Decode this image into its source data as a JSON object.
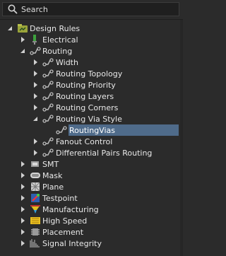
{
  "search": {
    "placeholder": "Search",
    "value": ""
  },
  "tree": {
    "root": {
      "label": "Design Rules",
      "expanded": true
    },
    "children": [
      {
        "label": "Electrical",
        "expanded": false
      },
      {
        "label": "Routing",
        "expanded": true,
        "children": [
          {
            "label": "Width",
            "expanded": false
          },
          {
            "label": "Routing Topology",
            "expanded": false
          },
          {
            "label": "Routing Priority",
            "expanded": false
          },
          {
            "label": "Routing Layers",
            "expanded": false
          },
          {
            "label": "Routing Corners",
            "expanded": false
          },
          {
            "label": "Routing Via Style",
            "expanded": true,
            "children": [
              {
                "label": "RoutingVias",
                "selected": true
              }
            ]
          },
          {
            "label": "Fanout Control",
            "expanded": false
          },
          {
            "label": "Differential Pairs Routing",
            "expanded": false
          }
        ]
      },
      {
        "label": "SMT",
        "expanded": false
      },
      {
        "label": "Mask",
        "expanded": false
      },
      {
        "label": "Plane",
        "expanded": false
      },
      {
        "label": "Testpoint",
        "expanded": false
      },
      {
        "label": "Manufacturing",
        "expanded": false
      },
      {
        "label": "High Speed",
        "expanded": false
      },
      {
        "label": "Placement",
        "expanded": false
      },
      {
        "label": "Signal Integrity",
        "expanded": false
      }
    ]
  },
  "colors": {
    "background": "#2b2b2b",
    "selection": "#4f6b8a",
    "text": "#e8e8e8"
  }
}
